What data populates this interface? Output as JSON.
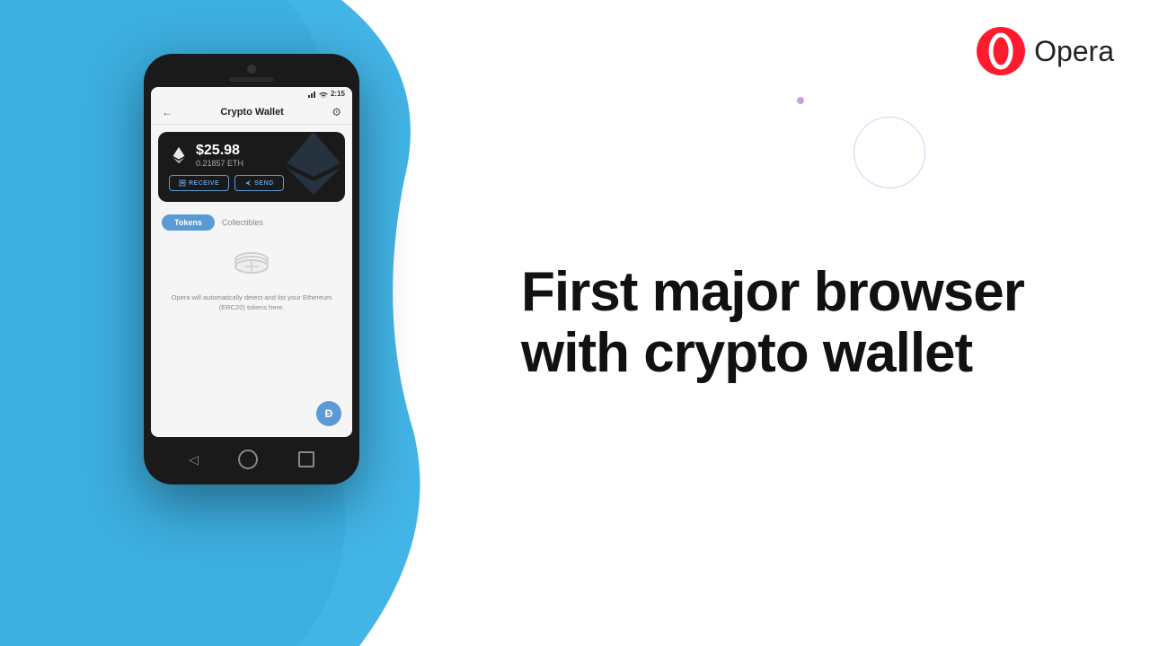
{
  "opera": {
    "logo_text": "Opera"
  },
  "background": {
    "blob_color": "#42b4e6"
  },
  "phone": {
    "status_bar": {
      "time": "2:15",
      "signal": "▲▼"
    },
    "header": {
      "back": "←",
      "title": "Crypto Wallet",
      "settings": "⚙"
    },
    "eth_card": {
      "amount": "$25.98",
      "eth_amount": "0.21857 ETH",
      "receive_label": "RECEIVE",
      "send_label": "SEND"
    },
    "tabs": {
      "tokens_label": "Tokens",
      "collectibles_label": "Collectibles"
    },
    "empty_state": {
      "text": "Opera will automatically detect and list your Ethereum (ERC20) tokens here."
    },
    "fab_label": "Ð"
  },
  "headline": {
    "line1": "First major browser",
    "line2": "with crypto wallet"
  }
}
